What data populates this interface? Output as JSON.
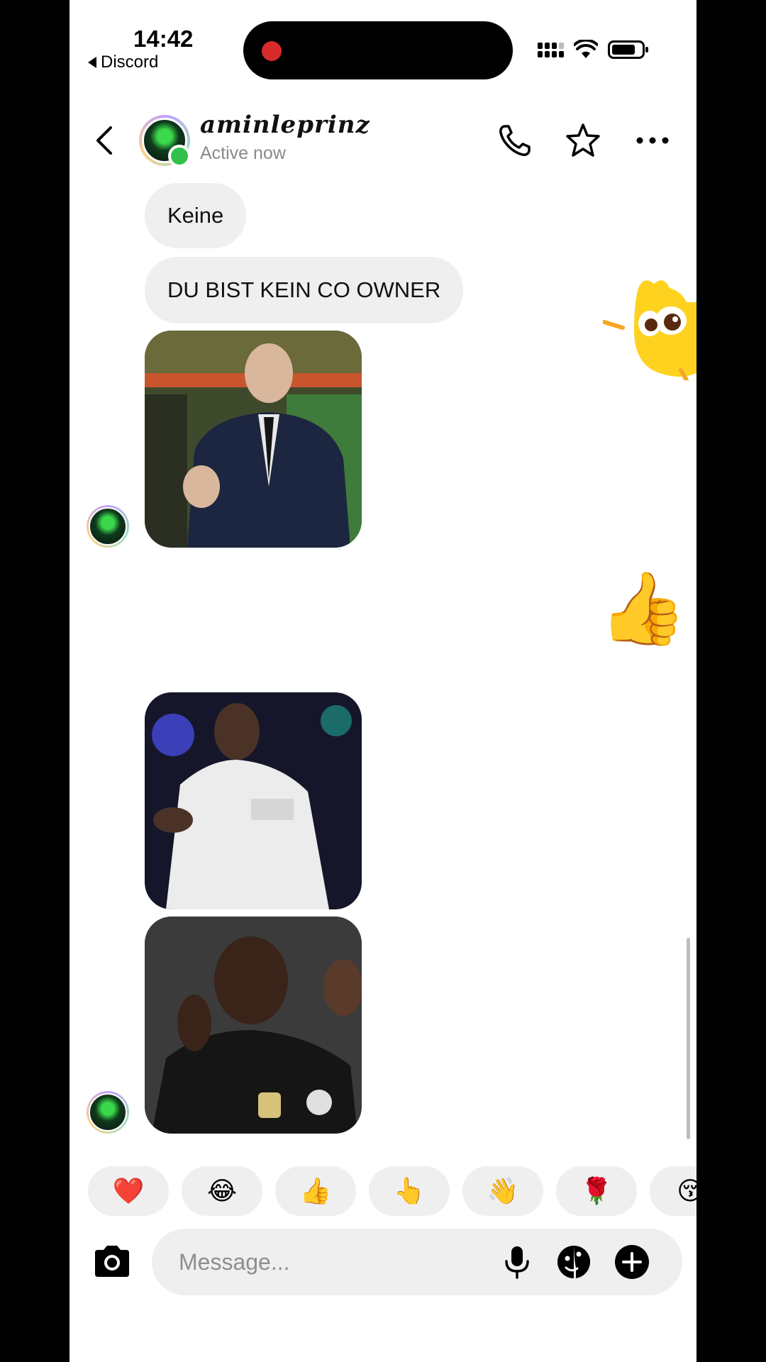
{
  "status_bar": {
    "time": "14:42",
    "back_app": "Discord"
  },
  "header": {
    "username": "aminleprinz",
    "status": "Active now"
  },
  "messages": [
    {
      "type": "text",
      "text": "Keine"
    },
    {
      "type": "text",
      "text": "DU BIST KEIN CO OWNER"
    },
    {
      "type": "gif",
      "subject": "man in suit gesturing"
    },
    {
      "type": "sticker",
      "emoji": "👍"
    },
    {
      "type": "gif",
      "subject": "football player white kit celebrating"
    },
    {
      "type": "gif",
      "subject": "football player phone-call celebration"
    }
  ],
  "quick_reactions": [
    "❤️",
    "😂",
    "👍",
    "👆",
    "👋",
    "🌹",
    "😚"
  ],
  "composer": {
    "placeholder": "Message..."
  },
  "icons": {
    "back": "chevron-left-icon",
    "call": "phone-icon",
    "favorite": "star-icon",
    "more": "more-horizontal-icon",
    "camera": "camera-icon",
    "voice": "microphone-icon",
    "sticker": "sticker-icon",
    "add": "plus-circle-icon"
  },
  "colors": {
    "online": "#31c14a",
    "bubble": "#efefef",
    "recording_dot": "#d92b2b"
  }
}
